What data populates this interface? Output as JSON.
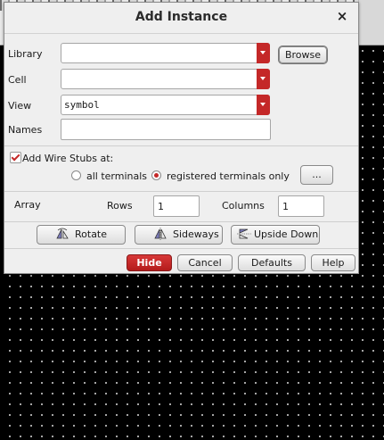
{
  "dialog": {
    "title": "Add Instance",
    "close_glyph": "×"
  },
  "fields": {
    "library": {
      "label": "Library",
      "value": ""
    },
    "cell": {
      "label": "Cell",
      "value": ""
    },
    "view": {
      "label": "View",
      "value": "symbol"
    },
    "names": {
      "label": "Names",
      "value": ""
    },
    "browse_label": "Browse"
  },
  "wire_stubs": {
    "label": "Add Wire Stubs at:",
    "checked": true,
    "option_all": "all terminals",
    "option_registered": "registered terminals only",
    "selected": "registered",
    "more_label": "..."
  },
  "array": {
    "label": "Array",
    "rows_label": "Rows",
    "rows_value": "1",
    "columns_label": "Columns",
    "columns_value": "1"
  },
  "transform_buttons": {
    "rotate": "Rotate",
    "sideways": "Sideways",
    "upside_down": "Upside Down",
    "rotate_icon": "rotate-icon",
    "sideways_icon": "sideways-icon",
    "upside_down_icon": "upside-down-icon"
  },
  "footer": {
    "hide": "Hide",
    "cancel": "Cancel",
    "defaults": "Defaults",
    "help": "Help"
  },
  "colors": {
    "accent": "#c42828",
    "dialog_bg": "#efefef",
    "canvas_bg": "#000000"
  }
}
